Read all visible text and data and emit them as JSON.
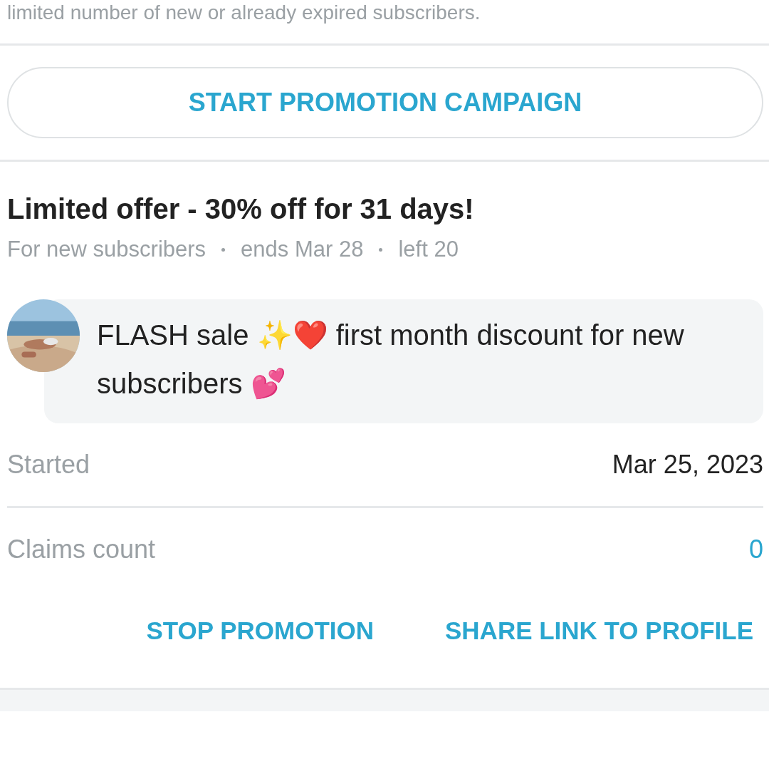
{
  "intro_text": "limited number of new or already expired subscribers.",
  "start_button": "START PROMOTION CAMPAIGN",
  "promotion": {
    "title": "Limited offer - 30% off for 31 days!",
    "meta": [
      "For new subscribers",
      "ends Mar 28",
      "left 20"
    ],
    "avatar": {
      "kind": "picture"
    },
    "message": "FLASH sale ✨❤️ first month discount for new subscribers 💕",
    "rows": [
      {
        "label": "Started",
        "value": "Mar 25, 2023",
        "kind": "plain"
      },
      {
        "label": "Claims count",
        "value": "0",
        "kind": "link"
      }
    ],
    "actions": [
      "STOP PROMOTION",
      "SHARE LINK TO PROFILE"
    ]
  }
}
